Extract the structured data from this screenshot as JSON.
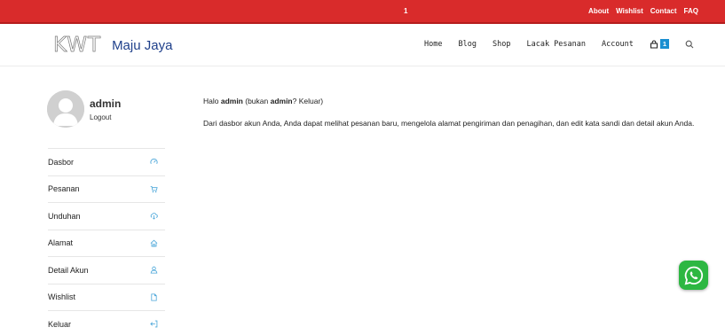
{
  "topbar": {
    "count": "1",
    "links": [
      "About",
      "Wishlist",
      "Contact",
      "FAQ"
    ]
  },
  "header": {
    "logo_mark": "KWT",
    "brand": "Maju Jaya",
    "nav": [
      "Home",
      "Blog",
      "Shop",
      "Lacak Pesanan",
      "Account"
    ],
    "cart_count": "1"
  },
  "user": {
    "name": "admin",
    "logout": "Logout"
  },
  "menu": [
    {
      "label": "Dasbor",
      "icon": "dashboard-icon"
    },
    {
      "label": "Pesanan",
      "icon": "cart-icon"
    },
    {
      "label": "Unduhan",
      "icon": "cloud-download-icon"
    },
    {
      "label": "Alamat",
      "icon": "home-icon"
    },
    {
      "label": "Detail Akun",
      "icon": "user-icon"
    },
    {
      "label": "Wishlist",
      "icon": "file-icon"
    },
    {
      "label": "Keluar",
      "icon": "logout-icon"
    }
  ],
  "content": {
    "greeting_prefix": "Halo ",
    "greeting_user": "admin",
    "greeting_mid": " (bukan ",
    "greeting_user2": "admin",
    "greeting_q": "? ",
    "greeting_link": "Keluar",
    "greeting_end": ")",
    "paragraph": "Dari dasbor akun Anda, Anda dapat melihat pesanan baru, mengelola alamat pengiriman dan penagihan, dan edit kata sandi dan detail akun Anda."
  },
  "colors": {
    "topbar": "#d92b2b",
    "accent": "#1a8fd1",
    "whatsapp": "#2db742"
  }
}
